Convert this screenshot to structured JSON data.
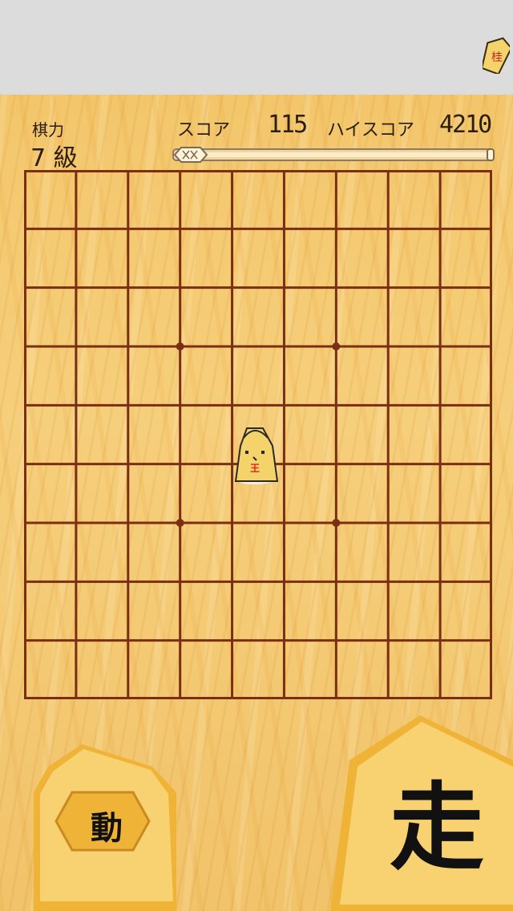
{
  "status": {
    "rank_label": "棋力",
    "rank_value": "7 級",
    "score_label": "スコア",
    "score_value": "115",
    "highscore_label": "ハイスコア",
    "highscore_value": "4210"
  },
  "progress": {
    "fraction": 0.1
  },
  "board": {
    "rows": 9,
    "cols": 9,
    "king_position": {
      "row": 5,
      "col": 5
    },
    "king_label": "王"
  },
  "corner_piece": {
    "label": "桂"
  },
  "buttons": {
    "move_label": "動",
    "run_label": "走"
  },
  "colors": {
    "wood": "#f3c66b",
    "grid": "#7a2e12",
    "piece": "#f4d46a",
    "button": "#f8d270",
    "button_dark": "#efb338",
    "king_mark": "#e02020"
  }
}
